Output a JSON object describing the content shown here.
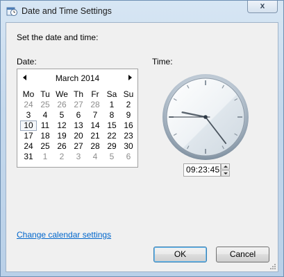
{
  "window": {
    "title": "Date and Time Settings",
    "close_glyph": "x",
    "icon": "date-time-icon"
  },
  "instruction": "Set the date and time:",
  "date_label": "Date:",
  "time_label": "Time:",
  "calendar": {
    "month_title": "March 2014",
    "weekdays": [
      "Mo",
      "Tu",
      "We",
      "Th",
      "Fr",
      "Sa",
      "Su"
    ],
    "weeks": [
      [
        {
          "d": "24",
          "other": true
        },
        {
          "d": "25",
          "other": true
        },
        {
          "d": "26",
          "other": true
        },
        {
          "d": "27",
          "other": true
        },
        {
          "d": "28",
          "other": true
        },
        {
          "d": "1"
        },
        {
          "d": "2"
        }
      ],
      [
        {
          "d": "3"
        },
        {
          "d": "4"
        },
        {
          "d": "5"
        },
        {
          "d": "6"
        },
        {
          "d": "7"
        },
        {
          "d": "8"
        },
        {
          "d": "9"
        }
      ],
      [
        {
          "d": "10",
          "today": true
        },
        {
          "d": "11"
        },
        {
          "d": "12"
        },
        {
          "d": "13"
        },
        {
          "d": "14"
        },
        {
          "d": "15"
        },
        {
          "d": "16"
        }
      ],
      [
        {
          "d": "17"
        },
        {
          "d": "18"
        },
        {
          "d": "19"
        },
        {
          "d": "20"
        },
        {
          "d": "21"
        },
        {
          "d": "22"
        },
        {
          "d": "23"
        }
      ],
      [
        {
          "d": "24"
        },
        {
          "d": "25"
        },
        {
          "d": "26"
        },
        {
          "d": "27"
        },
        {
          "d": "28"
        },
        {
          "d": "29"
        },
        {
          "d": "30"
        }
      ],
      [
        {
          "d": "31"
        },
        {
          "d": "1",
          "other": true
        },
        {
          "d": "2",
          "other": true
        },
        {
          "d": "3",
          "other": true
        },
        {
          "d": "4",
          "other": true
        },
        {
          "d": "5",
          "other": true
        },
        {
          "d": "6",
          "other": true
        }
      ]
    ],
    "selected_day": "10"
  },
  "clock": {
    "hours": 9,
    "minutes": 23,
    "seconds": 45
  },
  "time_field": {
    "hours": "09",
    "minutes": "23",
    "seconds": "45",
    "separator": ":"
  },
  "link_text": "Change calendar settings",
  "buttons": {
    "ok": "OK",
    "cancel": "Cancel"
  },
  "colors": {
    "link": "#0066cc",
    "other_month": "#8d8d8d"
  }
}
